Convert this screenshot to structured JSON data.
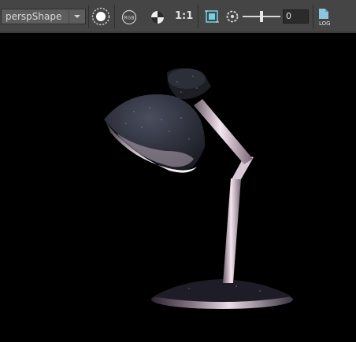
{
  "toolbar": {
    "camera_select": {
      "value": "perspShape"
    },
    "icons": {
      "render": "render-region-icon",
      "rgb": "rgb-channel-icon",
      "exposure": "exposure-icon",
      "display_real_size_label": "1:1",
      "frame": "frame-all-icon",
      "snapshot": "snapshot-icon",
      "log": "log-icon",
      "log_label": "LOG",
      "rgb_label": "RGB"
    },
    "gain_slider": {
      "value": 0
    },
    "gain_field": {
      "value": "0"
    }
  },
  "viewport": {
    "subject": "desk-lamp-render"
  }
}
